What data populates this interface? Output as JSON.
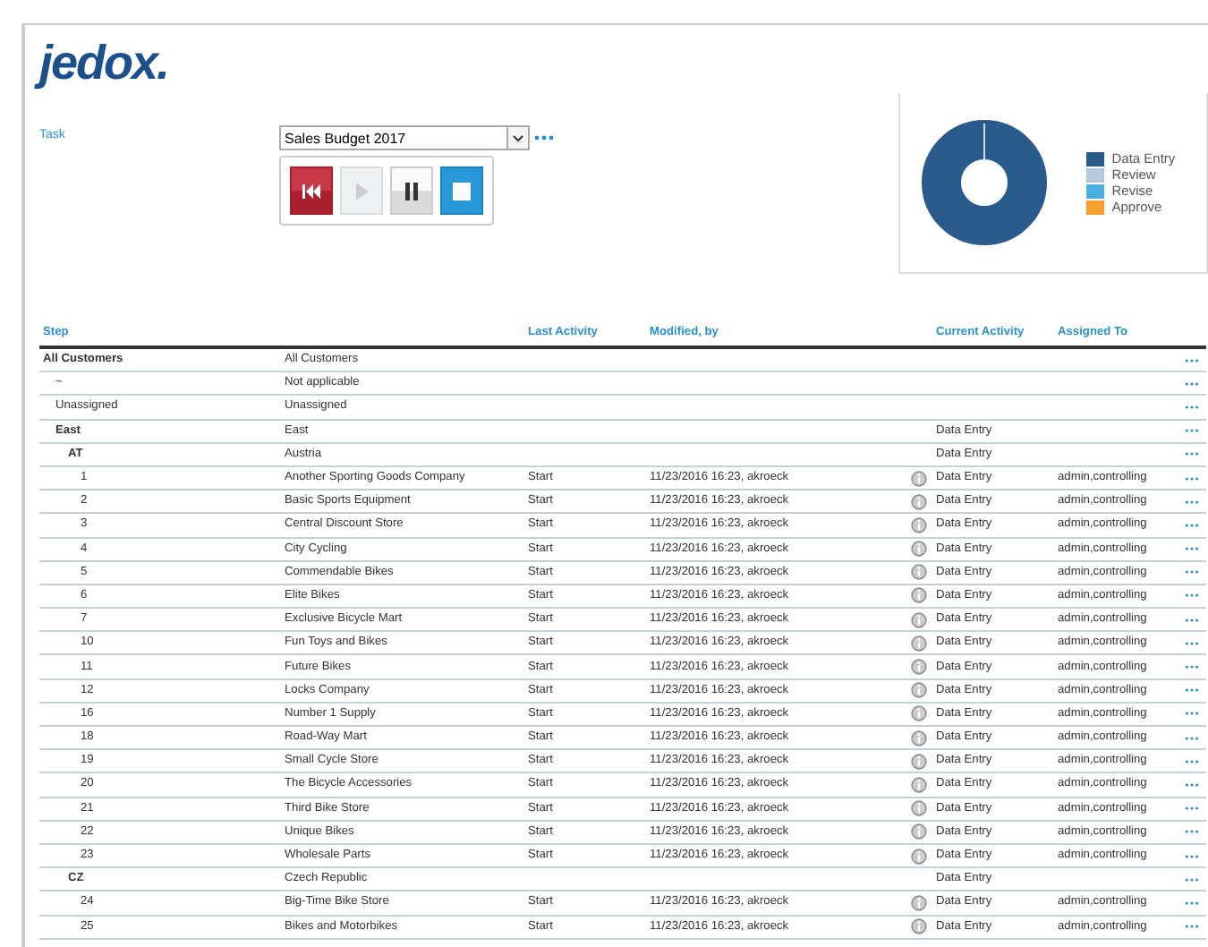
{
  "logo": "jedox.",
  "task": {
    "label": "Task",
    "value": "Sales Budget 2017"
  },
  "controls": [
    {
      "kind": "rewind",
      "disabled": false
    },
    {
      "kind": "play",
      "disabled": true
    },
    {
      "kind": "pause",
      "disabled": false
    },
    {
      "kind": "stop",
      "disabled": false
    }
  ],
  "legend": [
    {
      "label": "Data Entry",
      "color": "#285a8c"
    },
    {
      "label": "Review",
      "color": "#b4c8e0"
    },
    {
      "label": "Revise",
      "color": "#4aaee0"
    },
    {
      "label": "Approve",
      "color": "#f5a030"
    }
  ],
  "table": {
    "columns": [
      "Step",
      "",
      "Last Activity",
      "Modified, by",
      "",
      "Current Activity",
      "Assigned To"
    ],
    "rows": [
      {
        "step": "All Customers",
        "name": "All Customers",
        "children": [
          {
            "step": "~",
            "name": "Not applicable"
          },
          {
            "step": "Unassigned",
            "name": "Unassigned"
          },
          {
            "step": "East",
            "name": "East",
            "current": "Data Entry",
            "children": [
              {
                "step": "AT",
                "name": "Austria",
                "current": "Data Entry",
                "children": [
                  {
                    "step": "1",
                    "name": "Another Sporting Goods Company",
                    "last": "Start",
                    "modified": "11/23/2016 16:23, akroeck",
                    "current": "Data Entry",
                    "assigned": "admin,controlling"
                  },
                  {
                    "step": "2",
                    "name": "Basic Sports Equipment",
                    "last": "Start",
                    "modified": "11/23/2016 16:23, akroeck",
                    "current": "Data Entry",
                    "assigned": "admin,controlling"
                  },
                  {
                    "step": "3",
                    "name": "Central Discount Store",
                    "last": "Start",
                    "modified": "11/23/2016 16:23, akroeck",
                    "current": "Data Entry",
                    "assigned": "admin,controlling"
                  },
                  {
                    "step": "4",
                    "name": "City Cycling",
                    "last": "Start",
                    "modified": "11/23/2016 16:23, akroeck",
                    "current": "Data Entry",
                    "assigned": "admin,controlling"
                  },
                  {
                    "step": "5",
                    "name": "Commendable Bikes",
                    "last": "Start",
                    "modified": "11/23/2016 16:23, akroeck",
                    "current": "Data Entry",
                    "assigned": "admin,controlling"
                  },
                  {
                    "step": "6",
                    "name": "Elite Bikes",
                    "last": "Start",
                    "modified": "11/23/2016 16:23, akroeck",
                    "current": "Data Entry",
                    "assigned": "admin,controlling"
                  },
                  {
                    "step": "7",
                    "name": "Exclusive Bicycle Mart",
                    "last": "Start",
                    "modified": "11/23/2016 16:23, akroeck",
                    "current": "Data Entry",
                    "assigned": "admin,controlling"
                  },
                  {
                    "step": "10",
                    "name": "Fun Toys and Bikes",
                    "last": "Start",
                    "modified": "11/23/2016 16:23, akroeck",
                    "current": "Data Entry",
                    "assigned": "admin,controlling"
                  },
                  {
                    "step": "11",
                    "name": "Future Bikes",
                    "last": "Start",
                    "modified": "11/23/2016 16:23, akroeck",
                    "current": "Data Entry",
                    "assigned": "admin,controlling"
                  },
                  {
                    "step": "12",
                    "name": "Locks Company",
                    "last": "Start",
                    "modified": "11/23/2016 16:23, akroeck",
                    "current": "Data Entry",
                    "assigned": "admin,controlling"
                  },
                  {
                    "step": "16",
                    "name": "Number 1 Supply",
                    "last": "Start",
                    "modified": "11/23/2016 16:23, akroeck",
                    "current": "Data Entry",
                    "assigned": "admin,controlling"
                  },
                  {
                    "step": "18",
                    "name": "Road-Way Mart",
                    "last": "Start",
                    "modified": "11/23/2016 16:23, akroeck",
                    "current": "Data Entry",
                    "assigned": "admin,controlling"
                  },
                  {
                    "step": "19",
                    "name": "Small Cycle Store",
                    "last": "Start",
                    "modified": "11/23/2016 16:23, akroeck",
                    "current": "Data Entry",
                    "assigned": "admin,controlling"
                  },
                  {
                    "step": "20",
                    "name": "The Bicycle Accessories",
                    "last": "Start",
                    "modified": "11/23/2016 16:23, akroeck",
                    "current": "Data Entry",
                    "assigned": "admin,controlling"
                  },
                  {
                    "step": "21",
                    "name": "Third Bike Store",
                    "last": "Start",
                    "modified": "11/23/2016 16:23, akroeck",
                    "current": "Data Entry",
                    "assigned": "admin,controlling"
                  },
                  {
                    "step": "22",
                    "name": "Unique Bikes",
                    "last": "Start",
                    "modified": "11/23/2016 16:23, akroeck",
                    "current": "Data Entry",
                    "assigned": "admin,controlling"
                  },
                  {
                    "step": "23",
                    "name": "Wholesale Parts",
                    "last": "Start",
                    "modified": "11/23/2016 16:23, akroeck",
                    "current": "Data Entry",
                    "assigned": "admin,controlling"
                  }
                ]
              },
              {
                "step": "CZ",
                "name": "Czech Republic",
                "current": "Data Entry",
                "children": [
                  {
                    "step": "24",
                    "name": "Big-Time Bike Store",
                    "last": "Start",
                    "modified": "11/23/2016 16:23, akroeck",
                    "current": "Data Entry",
                    "assigned": "admin,controlling"
                  },
                  {
                    "step": "25",
                    "name": "Bikes and Motorbikes",
                    "last": "Start",
                    "modified": "11/23/2016 16:23, akroeck",
                    "current": "Data Entry",
                    "assigned": "admin,controlling"
                  }
                ]
              }
            ]
          }
        ]
      }
    ]
  }
}
